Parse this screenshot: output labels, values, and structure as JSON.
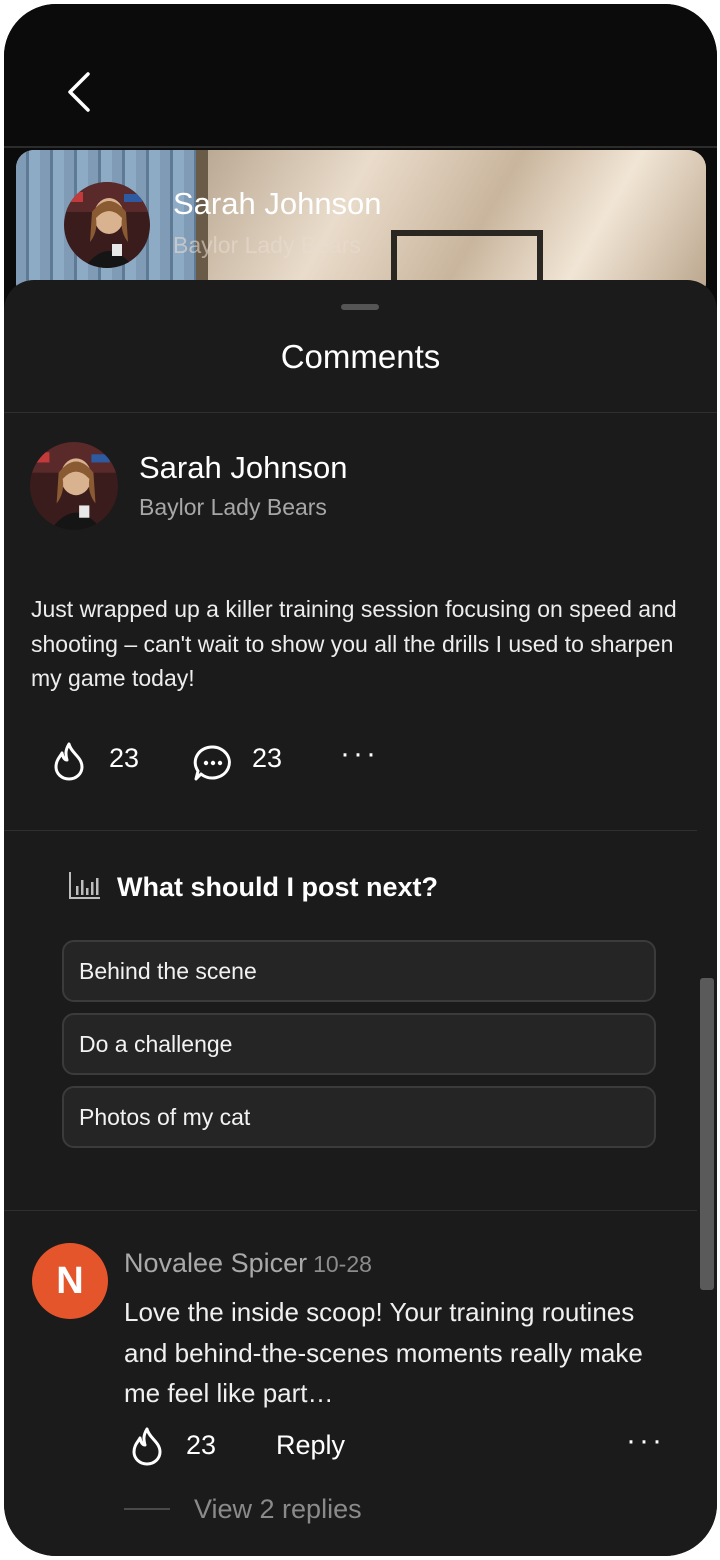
{
  "header": {
    "back_icon": "chevron-left-icon"
  },
  "profile_banner": {
    "name": "Sarah Johnson",
    "team": "Baylor Lady Bears"
  },
  "comments_sheet": {
    "title": "Comments"
  },
  "post": {
    "author": "Sarah Johnson",
    "team": "Baylor Lady Bears",
    "text": "Just wrapped up a killer training session focusing on speed and shooting – can't wait to show you all the drills I used to sharpen my game today!",
    "likes": "23",
    "comments": "23",
    "more_icon": "more-dots-icon"
  },
  "poll": {
    "icon": "bar-chart-icon",
    "question": "What should I post next?",
    "options": [
      "Behind the scene",
      "Do a challenge",
      "Photos of my cat"
    ]
  },
  "comment": {
    "avatar_initial": "N",
    "avatar_color": "#e4552b",
    "author": "Novalee Spicer",
    "date": "10-28",
    "text": "Love the inside scoop! Your training routines and behind-the-scenes moments really make me feel like part…",
    "likes": "23",
    "reply_label": "Reply",
    "view_replies": "View 2 replies"
  },
  "colors": {
    "background": "#1b1b1b",
    "top_bar": "#0b0b0b",
    "accent_avatar": "#e4552b"
  }
}
